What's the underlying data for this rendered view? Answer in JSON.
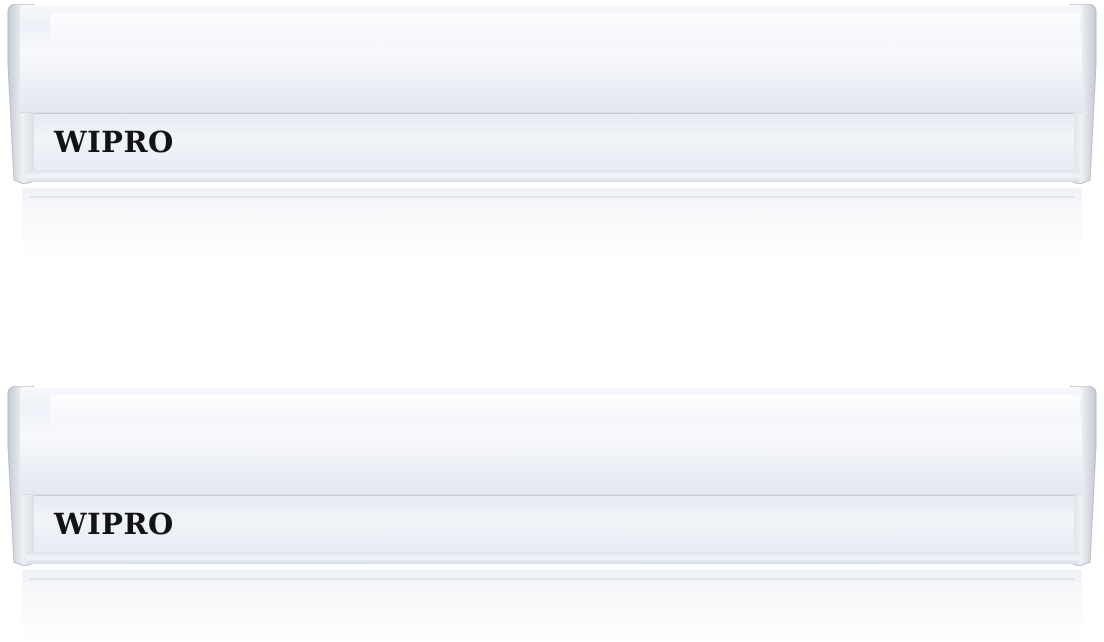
{
  "image": {
    "description_items": [
      {
        "id": "batten-1",
        "brand_label": "WIPRO"
      },
      {
        "id": "batten-2",
        "brand_label": "WIPRO"
      }
    ]
  },
  "colors": {
    "background": "#ffffff",
    "body": "#eef1f7",
    "logo_text": "#111317",
    "end_cap": "#d2d6dd"
  }
}
